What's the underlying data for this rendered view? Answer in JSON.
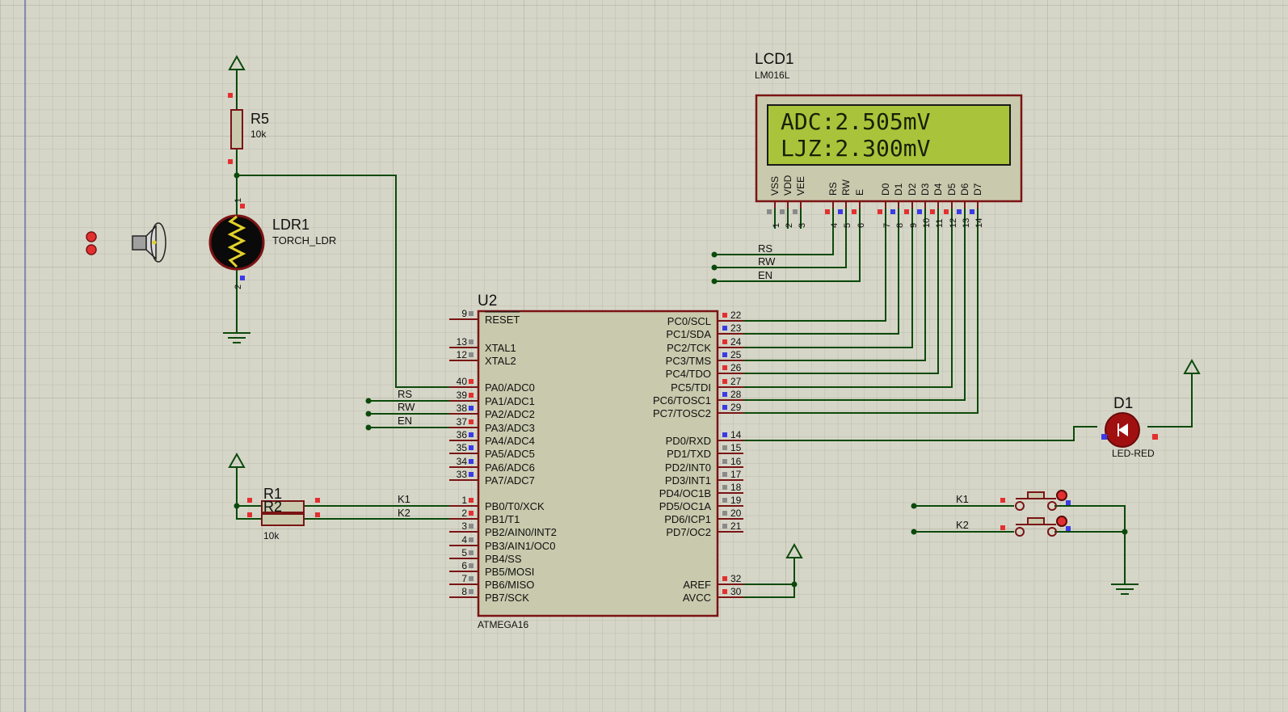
{
  "colors": {
    "background": "#d6d6c8",
    "grid": "#bcbcae",
    "wire": "#0b4a0b",
    "component_outline": "#7a1414",
    "component_fill": "#c9c9ad",
    "lcd_screen": "#a9c43a",
    "pin_red": "#e23030",
    "pin_blue": "#3a3ae6",
    "pin_gray": "#8a8a8a"
  },
  "lcd": {
    "ref": "LCD1",
    "model": "LM016L",
    "line1": "ADC:2.505mV",
    "line2": "LJZ:2.300mV",
    "pin_names": [
      "VSS",
      "VDD",
      "VEE",
      "RS",
      "RW",
      "E",
      "D0",
      "D1",
      "D2",
      "D3",
      "D4",
      "D5",
      "D6",
      "D7"
    ],
    "pin_numbers": [
      "1",
      "2",
      "3",
      "4",
      "5",
      "6",
      "7",
      "8",
      "9",
      "10",
      "11",
      "12",
      "13",
      "14"
    ],
    "net_labels": [
      "RS",
      "RW",
      "EN"
    ]
  },
  "mcu": {
    "ref": "U2",
    "model": "ATMEGA16",
    "left_pins": [
      {
        "num": "9",
        "name": "RESET"
      },
      {
        "num": "13",
        "name": "XTAL1"
      },
      {
        "num": "12",
        "name": "XTAL2"
      },
      {
        "num": "40",
        "name": "PA0/ADC0"
      },
      {
        "num": "39",
        "name": "PA1/ADC1"
      },
      {
        "num": "38",
        "name": "PA2/ADC2"
      },
      {
        "num": "37",
        "name": "PA3/ADC3"
      },
      {
        "num": "36",
        "name": "PA4/ADC4"
      },
      {
        "num": "35",
        "name": "PA5/ADC5"
      },
      {
        "num": "34",
        "name": "PA6/ADC6"
      },
      {
        "num": "33",
        "name": "PA7/ADC7"
      },
      {
        "num": "1",
        "name": "PB0/T0/XCK"
      },
      {
        "num": "2",
        "name": "PB1/T1"
      },
      {
        "num": "3",
        "name": "PB2/AIN0/INT2"
      },
      {
        "num": "4",
        "name": "PB3/AIN1/OC0"
      },
      {
        "num": "5",
        "name": "PB4/SS"
      },
      {
        "num": "6",
        "name": "PB5/MOSI"
      },
      {
        "num": "7",
        "name": "PB6/MISO"
      },
      {
        "num": "8",
        "name": "PB7/SCK"
      }
    ],
    "right_pins": [
      {
        "num": "22",
        "name": "PC0/SCL"
      },
      {
        "num": "23",
        "name": "PC1/SDA"
      },
      {
        "num": "24",
        "name": "PC2/TCK"
      },
      {
        "num": "25",
        "name": "PC3/TMS"
      },
      {
        "num": "26",
        "name": "PC4/TDO"
      },
      {
        "num": "27",
        "name": "PC5/TDI"
      },
      {
        "num": "28",
        "name": "PC6/TOSC1"
      },
      {
        "num": "29",
        "name": "PC7/TOSC2"
      },
      {
        "num": "14",
        "name": "PD0/RXD"
      },
      {
        "num": "15",
        "name": "PD1/TXD"
      },
      {
        "num": "16",
        "name": "PD2/INT0"
      },
      {
        "num": "17",
        "name": "PD3/INT1"
      },
      {
        "num": "18",
        "name": "PD4/OC1B"
      },
      {
        "num": "19",
        "name": "PD5/OC1A"
      },
      {
        "num": "20",
        "name": "PD6/ICP1"
      },
      {
        "num": "21",
        "name": "PD7/OC2"
      },
      {
        "num": "32",
        "name": "AREF"
      },
      {
        "num": "30",
        "name": "AVCC"
      }
    ],
    "net_labels": [
      "RS",
      "RW",
      "EN",
      "K1",
      "K2"
    ]
  },
  "r5": {
    "ref": "R5",
    "value": "10k"
  },
  "ldr": {
    "ref": "LDR1",
    "model": "TORCH_LDR",
    "pin1": "1",
    "pin2": "2"
  },
  "r1": {
    "ref": "R1"
  },
  "r2": {
    "ref": "R2",
    "value": "10k"
  },
  "led": {
    "ref": "D1",
    "model": "LED-RED"
  },
  "buttons": {
    "labels": [
      "K1",
      "K2"
    ]
  }
}
